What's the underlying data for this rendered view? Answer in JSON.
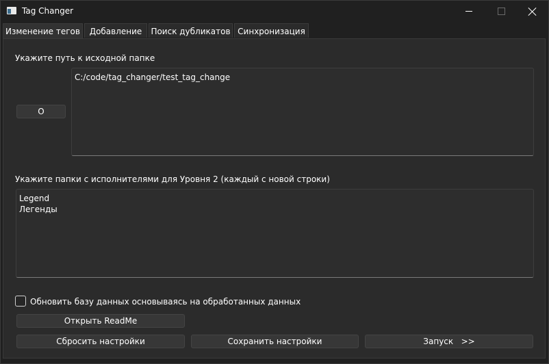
{
  "window": {
    "title": "Tag Changer",
    "controls": {
      "minimize": "minimize-icon",
      "maximize": "maximize-icon",
      "close": "close-icon"
    }
  },
  "tabs": [
    {
      "label": "Изменение тегов",
      "active": true
    },
    {
      "label": "Добавление",
      "active": false
    },
    {
      "label": "Поиск дубликатов",
      "active": false
    },
    {
      "label": "Синхронизация",
      "active": false
    }
  ],
  "main": {
    "source_label": "Укажите путь к исходной папке",
    "open_button": "O",
    "source_path": "C:/code/tag_changer/test_tag_change",
    "artists_label": "Укажите папки с исполнителями для Уровня 2 (каждый с новой строки)",
    "artists_folders": "Legend\nЛегенды",
    "update_db_checkbox": {
      "label": "Обновить базу данных основываясь на обработанных данных",
      "checked": false
    },
    "readme_button": "Открыть ReadMe",
    "reset_button": "Сбросить настройки",
    "save_button": "Сохранить настройки",
    "run_button": "Запуск   >>"
  },
  "colors": {
    "background": "#202020",
    "panel": "#2b2b2b",
    "button": "#373737",
    "text": "#ffffff"
  }
}
